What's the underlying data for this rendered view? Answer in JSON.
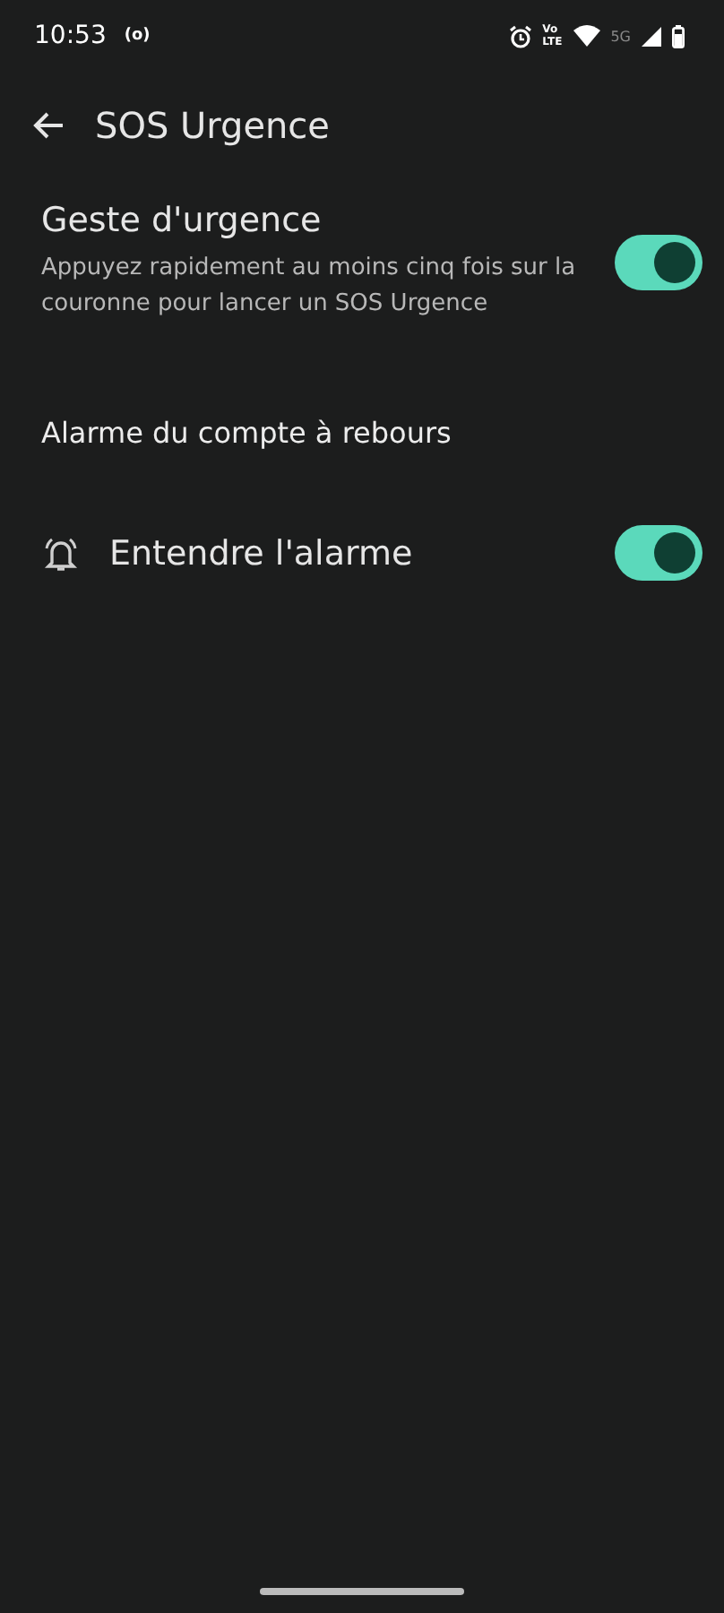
{
  "status_bar": {
    "time": "10:53",
    "hotspot_glyph": "(o)",
    "volte_top": "Vo",
    "volte_bottom": "LTE",
    "network": "5G"
  },
  "app_bar": {
    "title": "SOS Urgence"
  },
  "items": [
    {
      "kind": "switch",
      "title": "Geste d'urgence",
      "summary": "Appuyez rapidement au moins cinq fois sur la couronne pour lancer un SOS Urgence",
      "on": true
    },
    {
      "kind": "header",
      "title": "Alarme du compte à rebours"
    },
    {
      "kind": "icon-switch",
      "title": "Entendre l'alarme",
      "on": true
    }
  ]
}
